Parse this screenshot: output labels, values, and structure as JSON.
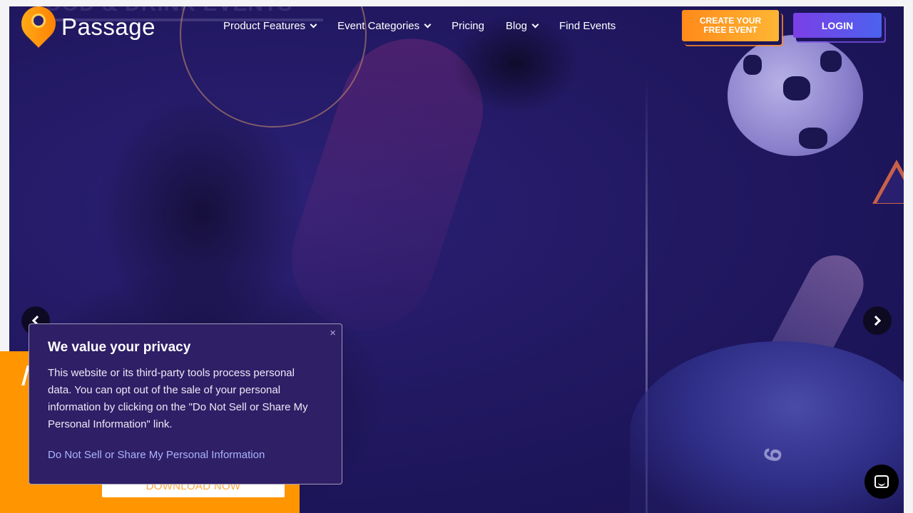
{
  "brand": {
    "name": "Passage"
  },
  "hero": {
    "faded_heading": "FOOD & DRINK EVENTS",
    "shirt_number": "6"
  },
  "nav": {
    "items": [
      {
        "label": "Product Features",
        "has_dropdown": true
      },
      {
        "label": "Event Categories",
        "has_dropdown": true
      },
      {
        "label": "Pricing",
        "has_dropdown": false
      },
      {
        "label": "Blog",
        "has_dropdown": true
      },
      {
        "label": "Find Events",
        "has_dropdown": false
      }
    ]
  },
  "header": {
    "create_button": "CREATE YOUR FREE EVENT",
    "login_button": "LOGIN"
  },
  "promo": {
    "download_button": "DOWNLOAD NOW"
  },
  "privacy": {
    "title": "We value your privacy",
    "body": "This website or its third-party tools process personal data. You can opt out of the sale of your personal information by clicking on the \"Do Not Sell or Share My Personal Information\" link.",
    "link": "Do Not Sell or Share My Personal Information",
    "close": "×"
  },
  "icons": {
    "prev": "chevron-left-icon",
    "next": "chevron-right-icon",
    "chat": "chat-icon",
    "close": "close-icon"
  },
  "colors": {
    "hero_bg": "#241a66",
    "accent_orange": "#ff9500",
    "login_gradient_start": "#7b3fe6",
    "login_gradient_end": "#4b62ee",
    "privacy_bg": "#2f1f66",
    "privacy_link": "#a9b4ff"
  }
}
